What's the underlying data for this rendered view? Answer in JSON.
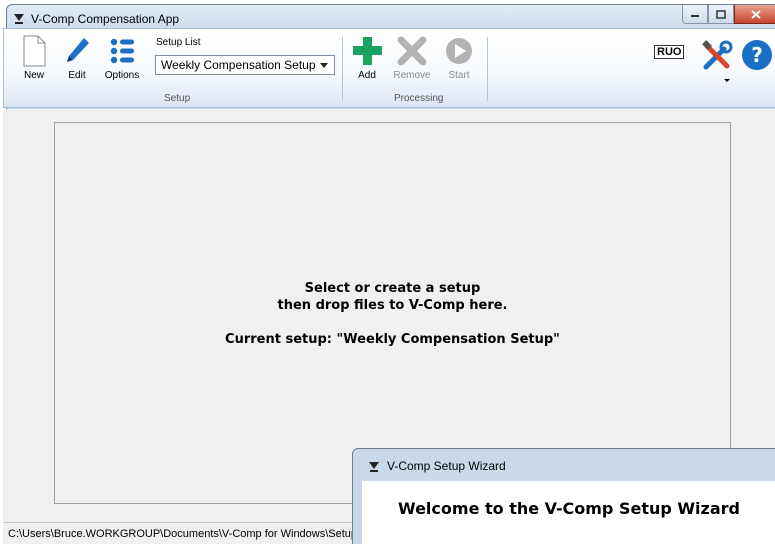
{
  "window": {
    "title": "V-Comp Compensation App"
  },
  "ribbon": {
    "new_label": "New",
    "edit_label": "Edit",
    "options_label": "Options",
    "setup_list_label": "Setup List",
    "setup_list_selected": "Weekly Compensation Setup",
    "setup_group_label": "Setup",
    "add_label": "Add",
    "remove_label": "Remove",
    "start_label": "Start",
    "processing_group_label": "Processing",
    "ruo_label": "RUO"
  },
  "drop_zone": {
    "line1": "Select or create a setup",
    "line2": "then drop files to V-Comp here.",
    "current_setup": "Current setup: \"Weekly Compensation Setup\""
  },
  "statusbar": {
    "path": "C:\\Users\\Bruce.WORKGROUP\\Documents\\V-Comp for Windows\\Setup"
  },
  "wizard": {
    "title": "V-Comp Setup Wizard",
    "heading": "Welcome to the V-Comp Setup Wizard"
  },
  "colors": {
    "add_green": "#1aa260",
    "edit_blue": "#1b6fc4",
    "disabled_gray": "#b3b3b3",
    "help_blue": "#1b6fc4",
    "tools_red": "#d9472b"
  }
}
